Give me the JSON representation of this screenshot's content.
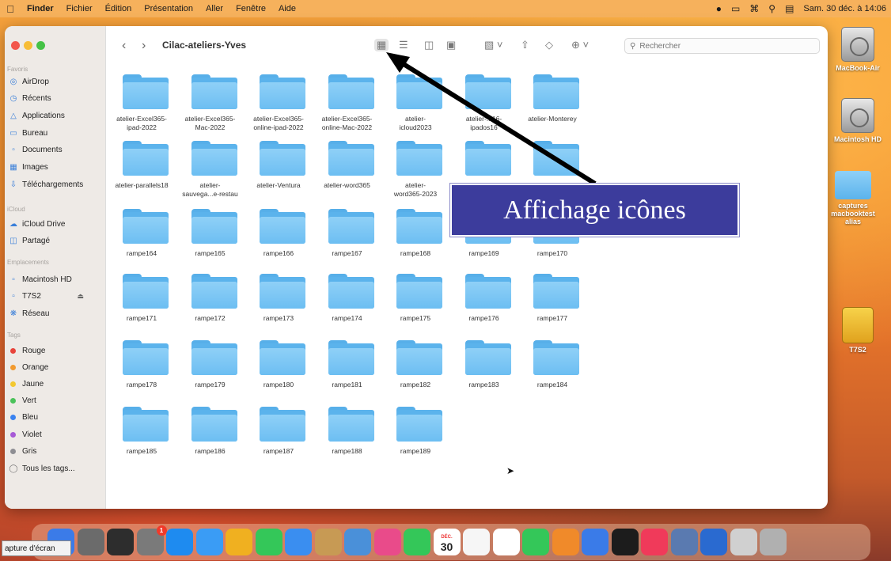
{
  "menubar": {
    "app": "Finder",
    "items": [
      "Fichier",
      "Édition",
      "Présentation",
      "Aller",
      "Fenêtre",
      "Aide"
    ],
    "clock": "Sam. 30 déc. à 14:06"
  },
  "window": {
    "title": "Cilac-ateliers-Yves",
    "search_placeholder": "Rechercher"
  },
  "sidebar": {
    "favoris_title": "Favoris",
    "favoris": [
      {
        "label": "AirDrop",
        "icon": "airdrop-icon"
      },
      {
        "label": "Récents",
        "icon": "clock-icon"
      },
      {
        "label": "Applications",
        "icon": "applications-icon"
      },
      {
        "label": "Bureau",
        "icon": "desktop-icon"
      },
      {
        "label": "Documents",
        "icon": "document-icon"
      },
      {
        "label": "Images",
        "icon": "images-icon"
      },
      {
        "label": "Téléchargements",
        "icon": "download-icon"
      }
    ],
    "icloud_title": "iCloud",
    "icloud": [
      {
        "label": "iCloud Drive",
        "icon": "cloud-icon"
      },
      {
        "label": "Partagé",
        "icon": "shared-folder-icon"
      }
    ],
    "emplacements_title": "Emplacements",
    "emplacements": [
      {
        "label": "Macintosh HD",
        "icon": "disk-icon"
      },
      {
        "label": "T7S2",
        "icon": "disk-icon"
      },
      {
        "label": "Réseau",
        "icon": "network-icon"
      }
    ],
    "tags_title": "Tags",
    "tags": [
      {
        "label": "Rouge",
        "color": "#e8433a"
      },
      {
        "label": "Orange",
        "color": "#f29a2e"
      },
      {
        "label": "Jaune",
        "color": "#f3c82f"
      },
      {
        "label": "Vert",
        "color": "#4bc25a"
      },
      {
        "label": "Bleu",
        "color": "#3a82f0"
      },
      {
        "label": "Violet",
        "color": "#a75ad6"
      },
      {
        "label": "Gris",
        "color": "#8e8e93"
      }
    ],
    "all_tags": "Tous les tags..."
  },
  "folders": [
    [
      "atelier-Excel365-\nipad-2022",
      "atelier-Excel365-\nMac-2022",
      "atelier-Excel365-\nonline-ipad-2022",
      "atelier-Excel365-\nonline-Mac-2022",
      "atelier-\nicloud2023",
      "atelier-...16-\nipados16",
      "atelier-Monterey"
    ],
    [
      "atelier-parallels18",
      "atelier-\nsauvega...e-restau",
      "atelier-Ventura",
      "atelier-word365",
      "atelier-\nword365-2023",
      "",
      ""
    ],
    [
      "rampe164",
      "rampe165",
      "rampe166",
      "rampe167",
      "rampe168",
      "rampe169",
      "rampe170"
    ],
    [
      "rampe171",
      "rampe172",
      "rampe173",
      "rampe174",
      "rampe175",
      "rampe176",
      "rampe177"
    ],
    [
      "rampe178",
      "rampe179",
      "rampe180",
      "rampe181",
      "rampe182",
      "rampe183",
      "rampe184"
    ],
    [
      "rampe185",
      "rampe186",
      "rampe187",
      "rampe188",
      "rampe189"
    ]
  ],
  "callout": "Affichage icônes",
  "desktop": [
    {
      "label": "MacBook-Air",
      "kind": "disk"
    },
    {
      "label": "Macintosh HD",
      "kind": "disk"
    },
    {
      "label": "captures\nmacbooktest alias",
      "kind": "folder"
    },
    {
      "label": "T7S2",
      "kind": "yellow-disk"
    }
  ],
  "tooltip": "apture d'écran",
  "dock_calendar": {
    "month": "DÉC.",
    "day": "30"
  },
  "dock_badge": "1"
}
